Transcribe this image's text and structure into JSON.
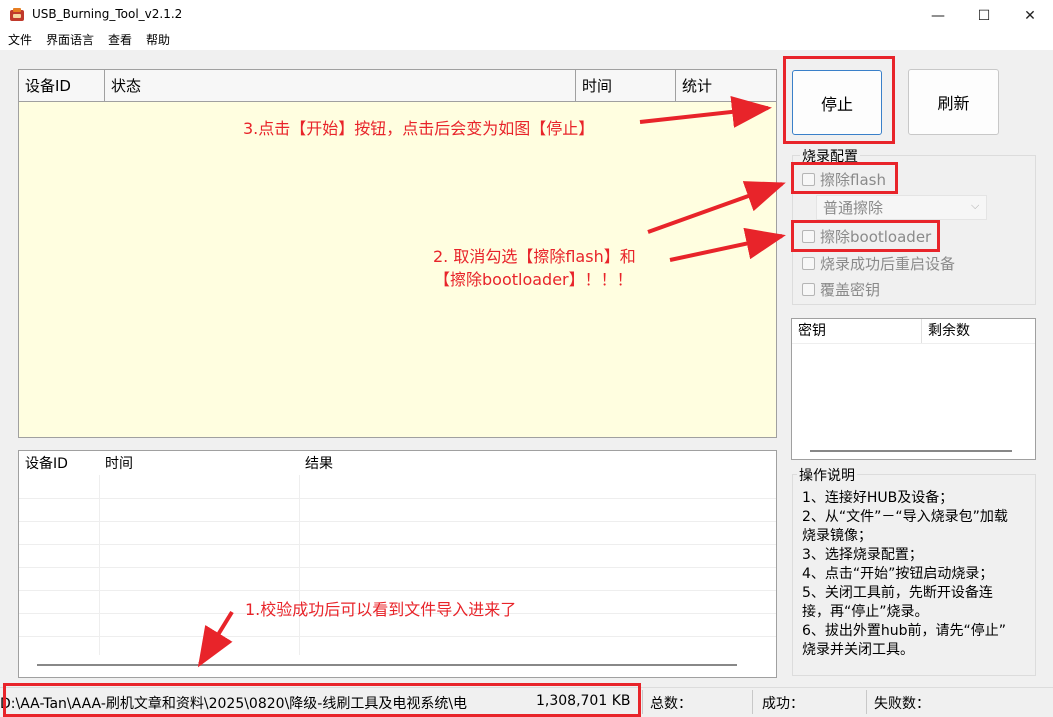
{
  "window": {
    "title": "USB_Burning_Tool_v2.1.2",
    "minimize_symbol": "—",
    "maximize_symbol": "☐",
    "close_symbol": "✕"
  },
  "menu": [
    "文件",
    "界面语言",
    "查看",
    "帮助"
  ],
  "device_table": {
    "columns": [
      "设备ID",
      "状态",
      "时间",
      "统计"
    ],
    "background": "#fffee0"
  },
  "result_table": {
    "columns": [
      "设备ID",
      "时间",
      "结果"
    ]
  },
  "buttons": {
    "stop": "停止",
    "refresh": "刷新"
  },
  "burn_config": {
    "title": "烧录配置",
    "erase_flash": {
      "label": "擦除flash",
      "checked": false
    },
    "erase_mode": {
      "value": "普通擦除"
    },
    "erase_bootloader": {
      "label": "擦除bootloader",
      "checked": false
    },
    "reboot_after": {
      "label": "烧录成功后重启设备",
      "checked": false
    },
    "overwrite_key": {
      "label": "覆盖密钥",
      "checked": false
    }
  },
  "key_table": {
    "columns": [
      "密钥",
      "剩余数"
    ]
  },
  "instructions": {
    "title": "操作说明",
    "lines": [
      "1、连接好HUB及设备；",
      "2、从“文件”－“导入烧录包”加载",
      "烧录镜像；",
      "3、选择烧录配置；",
      "4、点击“开始”按钮启动烧录；",
      "5、关闭工具前，先断开设备连",
      "接，再“停止”烧录。",
      "6、拔出外置hub前，请先“停止”",
      "烧录并关闭工具。"
    ]
  },
  "status_bar": {
    "file_path": "D:\\AA-Tan\\AAA-刷机文章和资料\\2025\\0820\\降级-线刷工具及电视系统\\电",
    "file_size": "1,308,701 KB",
    "total_label": "总数：",
    "success_label": "成功：",
    "fail_label": "失败数："
  },
  "annotations": {
    "step1": "1.校验成功后可以看到文件导入进来了",
    "step2_line1": "2. 取消勾选【擦除flash】和",
    "step2_line2": "【擦除bootloader】！！！",
    "step3": "3.点击【开始】按钮，点击后会变为如图【停止】",
    "color": "#e8242a"
  }
}
